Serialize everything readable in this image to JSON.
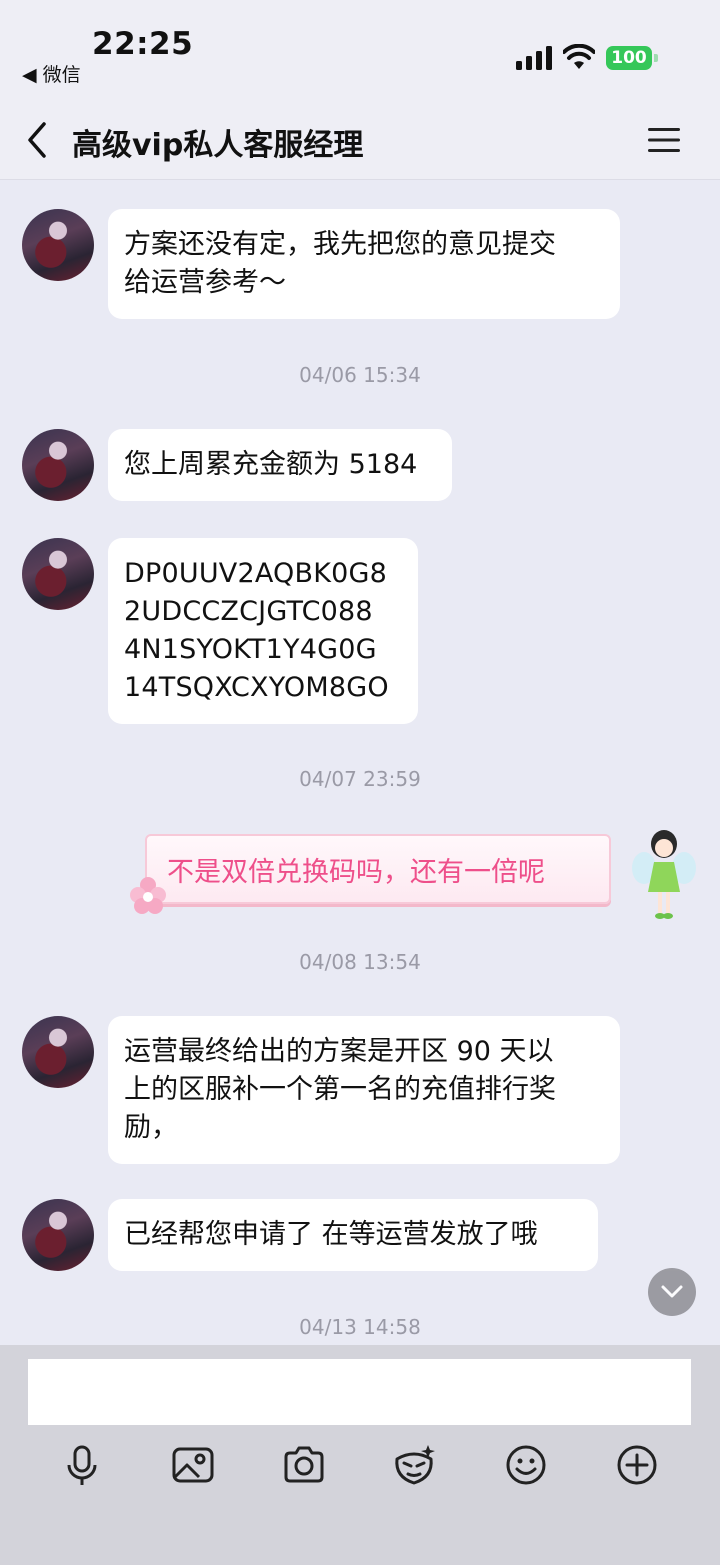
{
  "status_bar": {
    "time": "22:25",
    "back_app": "◀ 微信",
    "battery": "100"
  },
  "header": {
    "title": "高级vip私人客服经理"
  },
  "messages": [
    {
      "text_lines": [
        "方案还没有定，我先把您的意见提交",
        "给运营参考～"
      ]
    },
    {
      "timestamp": "04/06 15:34"
    },
    {
      "text_lines": [
        "您上周累充金额为 5184"
      ]
    },
    {
      "text_lines": [
        "DP0UUV2AQBK0G8",
        "2UDCCZCJGTC088",
        "4N1SYOKT1Y4G0G",
        "14TSQXCXYOM8GO"
      ]
    },
    {
      "timestamp": "04/07 23:59"
    },
    {
      "outgoing": true,
      "text_lines": [
        "不是双倍兑换码吗，还有一倍呢"
      ]
    },
    {
      "timestamp": "04/08 13:54"
    },
    {
      "text_lines": [
        "运营最终给出的方案是开区 90 天以",
        "上的区服补一个第一名的充值排行奖",
        "励，"
      ]
    },
    {
      "text_lines": [
        "已经帮您申请了 在等运营发放了哦"
      ]
    },
    {
      "timestamp": "04/13 14:58"
    }
  ],
  "composer": {
    "input_value": "",
    "tools": [
      "microphone-icon",
      "image-icon",
      "camera-icon",
      "sticker-icon",
      "emoji-icon",
      "plus-icon"
    ]
  },
  "colors": {
    "background": "#e9eaf4",
    "bubble": "#ffffff",
    "outgoing_text": "#ee4f8a",
    "timestamp": "#9a9aa6",
    "battery": "#35c759"
  }
}
